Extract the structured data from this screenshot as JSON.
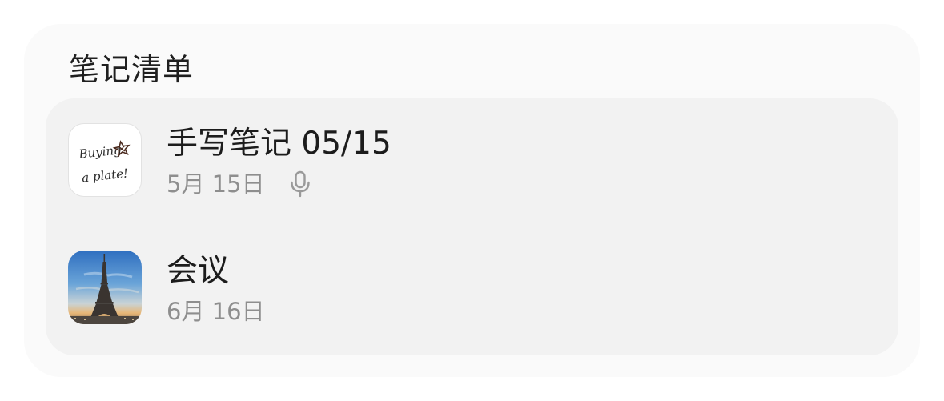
{
  "widget": {
    "title": "笔记清单"
  },
  "notes": [
    {
      "title": "手写笔记 05/15",
      "date": "5月 15日",
      "has_audio": true,
      "thumbnail": "handwriting-thumbnail",
      "thumbnail_text": [
        "Buying",
        "a plate!"
      ]
    },
    {
      "title": "会议",
      "date": "6月 16日",
      "has_audio": false,
      "thumbnail": "eiffel-tower-photo"
    }
  ],
  "icons": {
    "audio": "microphone-icon"
  },
  "colors": {
    "widget_bg": "#fafafa",
    "card_bg": "#f2f2f2",
    "title_text": "#1c1c1c",
    "meta_text": "#8e8e8e"
  }
}
